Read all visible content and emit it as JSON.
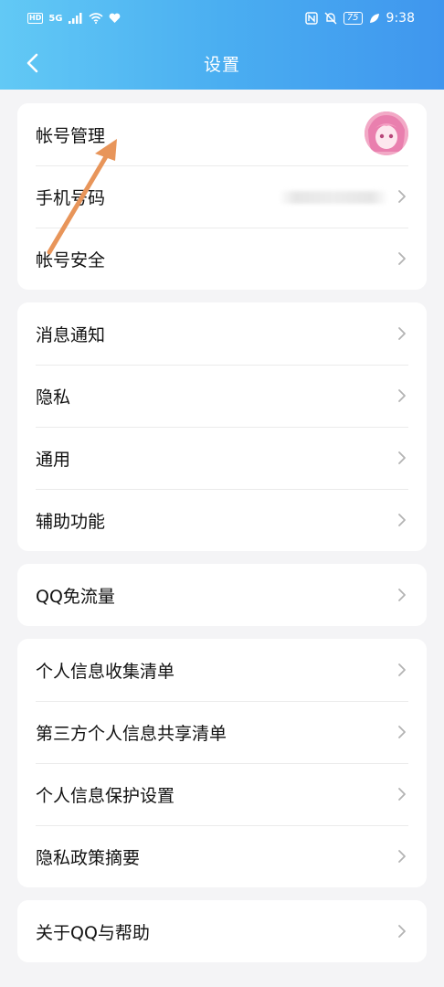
{
  "status_bar": {
    "left_hd": "HD",
    "left_net": "5G",
    "battery": "75",
    "time": "9:38"
  },
  "nav": {
    "title": "设置"
  },
  "groups": [
    {
      "items": [
        {
          "label": "帐号管理",
          "trailing": "avatar"
        },
        {
          "label": "手机号码",
          "trailing": "hidden-value"
        },
        {
          "label": "帐号安全",
          "trailing": "chevron"
        }
      ]
    },
    {
      "items": [
        {
          "label": "消息通知"
        },
        {
          "label": "隐私"
        },
        {
          "label": "通用"
        },
        {
          "label": "辅助功能"
        }
      ]
    },
    {
      "items": [
        {
          "label": "QQ免流量"
        }
      ]
    },
    {
      "items": [
        {
          "label": "个人信息收集清单"
        },
        {
          "label": "第三方个人信息共享清单"
        },
        {
          "label": "个人信息保护设置"
        },
        {
          "label": "隐私政策摘要"
        }
      ]
    },
    {
      "items": [
        {
          "label": "关于QQ与帮助"
        }
      ]
    }
  ],
  "colors": {
    "header_start": "#62c9f5",
    "header_end": "#3f96ee",
    "annotation_arrow": "#e8955a"
  }
}
